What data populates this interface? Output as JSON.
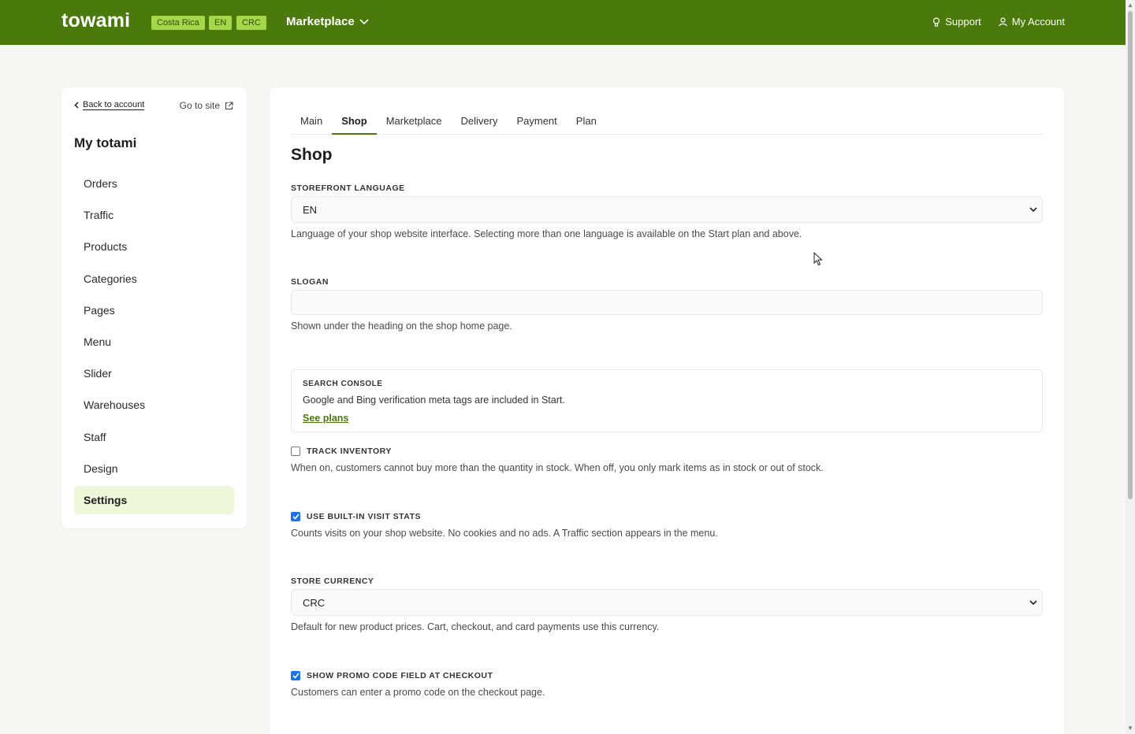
{
  "topbar": {
    "logo": "towami",
    "region": "Costa Rica",
    "lang": "EN",
    "currency": "CRC",
    "marketplace": "Marketplace",
    "support": "Support",
    "account": "My Account",
    "color": "#4a7a0c"
  },
  "sidebar": {
    "back": "Back to account",
    "goto": "Go to site",
    "title": "My totami",
    "items": [
      "Orders",
      "Traffic",
      "Products",
      "Categories",
      "Pages",
      "Menu",
      "Slider",
      "Warehouses",
      "Staff",
      "Design",
      "Settings"
    ],
    "active": "Settings"
  },
  "tabs": [
    "Main",
    "Shop",
    "Marketplace",
    "Delivery",
    "Payment",
    "Plan"
  ],
  "active_tab": "Shop",
  "page": {
    "title": "Shop",
    "storefront_language": {
      "label": "STOREFRONT LANGUAGE",
      "value": "EN",
      "help": "Language of your shop website interface. Selecting more than one language is available on the Start plan and above."
    },
    "slogan": {
      "label": "SLOGAN",
      "value": "",
      "help": "Shown under the heading on the shop home page."
    },
    "search_console": {
      "label": "SEARCH CONSOLE",
      "text": "Google and Bing verification meta tags are included in Start.",
      "link": "See plans"
    },
    "track_inventory": {
      "label": "TRACK INVENTORY",
      "checked": false,
      "help": "When on, customers cannot buy more than the quantity in stock. When off, you only mark items as in stock or out of stock."
    },
    "visit_stats": {
      "label": "USE BUILT-IN VISIT STATS",
      "checked": true,
      "help": "Counts visits on your shop website. No cookies and no ads. A Traffic section appears in the menu."
    },
    "store_currency": {
      "label": "STORE CURRENCY",
      "value": "CRC",
      "help": "Default for new product prices. Cart, checkout, and card payments use this currency."
    },
    "promo_code": {
      "label": "SHOW PROMO CODE FIELD AT CHECKOUT",
      "checked": true,
      "help": "Customers can enter a promo code on the checkout page."
    }
  }
}
